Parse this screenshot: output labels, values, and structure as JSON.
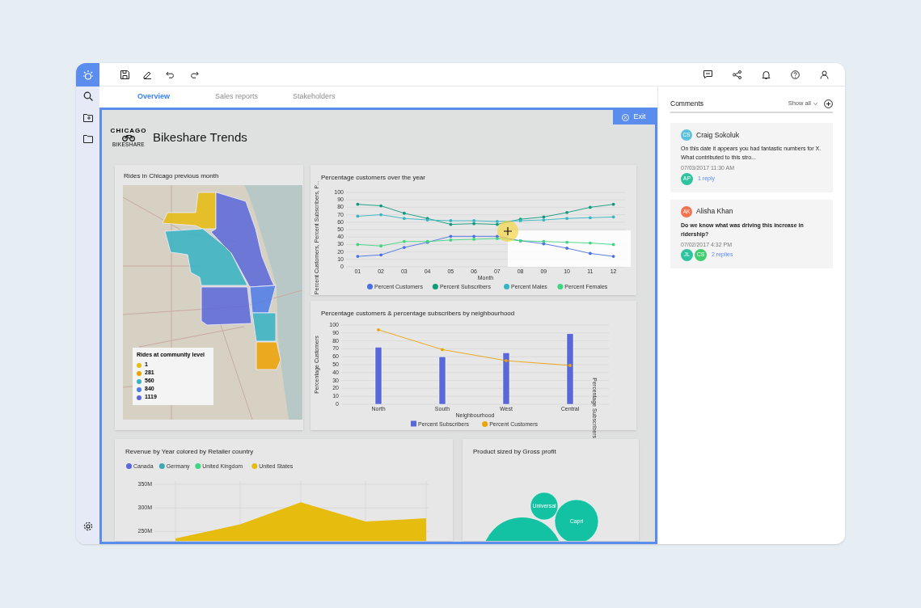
{
  "tabs": [
    {
      "label": "Overview",
      "selected": true
    },
    {
      "label": "Sales reports",
      "selected": false
    },
    {
      "label": "Stakeholders",
      "selected": false
    }
  ],
  "exit_button": "Exit",
  "dashboard": {
    "logo": {
      "top": "CHICAGO",
      "bottom": "BIKESHARE"
    },
    "title": "Bikeshare Trends",
    "map_card": {
      "title": "Rides in Chicago previous month",
      "legend_title": "Rides at community level",
      "legend": [
        {
          "label": "1",
          "color": "#e6bc0e"
        },
        {
          "label": "281",
          "color": "#eea204"
        },
        {
          "label": "560",
          "color": "#35b3c4"
        },
        {
          "label": "840",
          "color": "#4c7be8"
        },
        {
          "label": "1119",
          "color": "#5a67d8"
        }
      ]
    },
    "line_card": {
      "title": "Percentage customers over the year",
      "chart_data": {
        "type": "line",
        "grid": true,
        "legend": "bottom",
        "xlabel": "Month",
        "ylabel": "Percent Customers, Percent Subscribers, P...",
        "categories": [
          "01",
          "02",
          "03",
          "04",
          "05",
          "06",
          "07",
          "08",
          "09",
          "10",
          "11",
          "12"
        ],
        "ylim": [
          0,
          100
        ],
        "yticks": [
          0,
          10,
          20,
          30,
          40,
          50,
          60,
          70,
          80,
          90,
          100
        ],
        "series": [
          {
            "name": "Percent Customers",
            "color": "#4a6fe3",
            "values": [
              14,
              16,
              26,
              33,
              41,
              41,
              41,
              35,
              31,
              25,
              18,
              14
            ]
          },
          {
            "name": "Percent Subscribers",
            "color": "#0f9a7a",
            "values": [
              84,
              82,
              72,
              65,
              57,
              58,
              57,
              64,
              67,
              73,
              80,
              84
            ]
          },
          {
            "name": "Percent Males",
            "color": "#33b5c2",
            "values": [
              68,
              70,
              65,
              63,
              62,
              62,
              61,
              62,
              63,
              65,
              66,
              67
            ]
          },
          {
            "name": "Percent Females",
            "color": "#3fd67f",
            "values": [
              30,
              28,
              34,
              34,
              36,
              37,
              38,
              35,
              34,
              33,
              32,
              30
            ]
          }
        ]
      }
    },
    "bar_card": {
      "title": "Percentage customers & percentage subscribers by neighbourhood",
      "right_axis_title": "Percentage Subscribers",
      "chart_data": {
        "type": "bar",
        "grid": true,
        "legend": "bottom",
        "xlabel": "Neighbourhood",
        "ylabel": "Percentage Customers",
        "categories": [
          "North",
          "South",
          "West",
          "Central"
        ],
        "ylim": [
          0,
          100
        ],
        "yticks": [
          0,
          10,
          20,
          30,
          40,
          50,
          60,
          70,
          80,
          90,
          100
        ],
        "series": [
          {
            "name": "Percent Subscribers",
            "color": "#5a67d8",
            "type": "bar",
            "values": [
              72,
              60,
              65,
              89
            ]
          },
          {
            "name": "Percent Customers",
            "color": "#eea204",
            "type": "line",
            "values": [
              94,
              69,
              55,
              49
            ]
          }
        ]
      }
    },
    "revenue_card": {
      "title": "Revenue by Year colored by Retailer country",
      "chart_data": {
        "type": "area",
        "grid": true,
        "legend": "top",
        "ylim": [
          230,
          350
        ],
        "yticks": [
          {
            "value": 250,
            "label": "250M"
          },
          {
            "value": 300,
            "label": "300M"
          },
          {
            "value": 350,
            "label": "350M"
          }
        ],
        "series": [
          {
            "name": "Canada",
            "color": "#5a67d8",
            "values": [
              null,
              null,
              null,
              null,
              null
            ]
          },
          {
            "name": "Germany",
            "color": "#3fa8b5",
            "values": [
              null,
              null,
              null,
              null,
              null
            ]
          },
          {
            "name": "United Kingdom",
            "color": "#3fd67f",
            "values": [
              null,
              null,
              null,
              null,
              null
            ]
          },
          {
            "name": "United States",
            "color": "#e6bc0e",
            "values": [
              235,
              265,
              312,
              271,
              278
            ]
          }
        ]
      }
    },
    "bubble_card": {
      "title": "Product sized by Gross profit",
      "bubbles": [
        {
          "label": "Universal"
        },
        {
          "label": "Capri"
        }
      ]
    }
  },
  "comments": {
    "title": "Comments",
    "filter": "Show all",
    "items": [
      {
        "initials": "CS",
        "name": "Craig Sokoluk",
        "color": "#5bc0de",
        "text": "On this date it appears you had fantastic numbers for X. What contributed to this stro...",
        "bold": false,
        "date": "07/03/2017 11:30 AM",
        "reply_avatars": [
          {
            "initials": "AP",
            "color": "#2ec4a0"
          }
        ],
        "replies": "1 reply"
      },
      {
        "initials": "AK",
        "name": "Alisha Khan",
        "color": "#f2734f",
        "text": "Do we know what was driving this increase in ridership?",
        "bold": true,
        "date": "07/02/2017 4:32 PM",
        "reply_avatars": [
          {
            "initials": "JL",
            "color": "#2ec4a0"
          },
          {
            "initials": "CS",
            "color": "#3fcf6f"
          }
        ],
        "replies": "2 replies"
      }
    ]
  }
}
